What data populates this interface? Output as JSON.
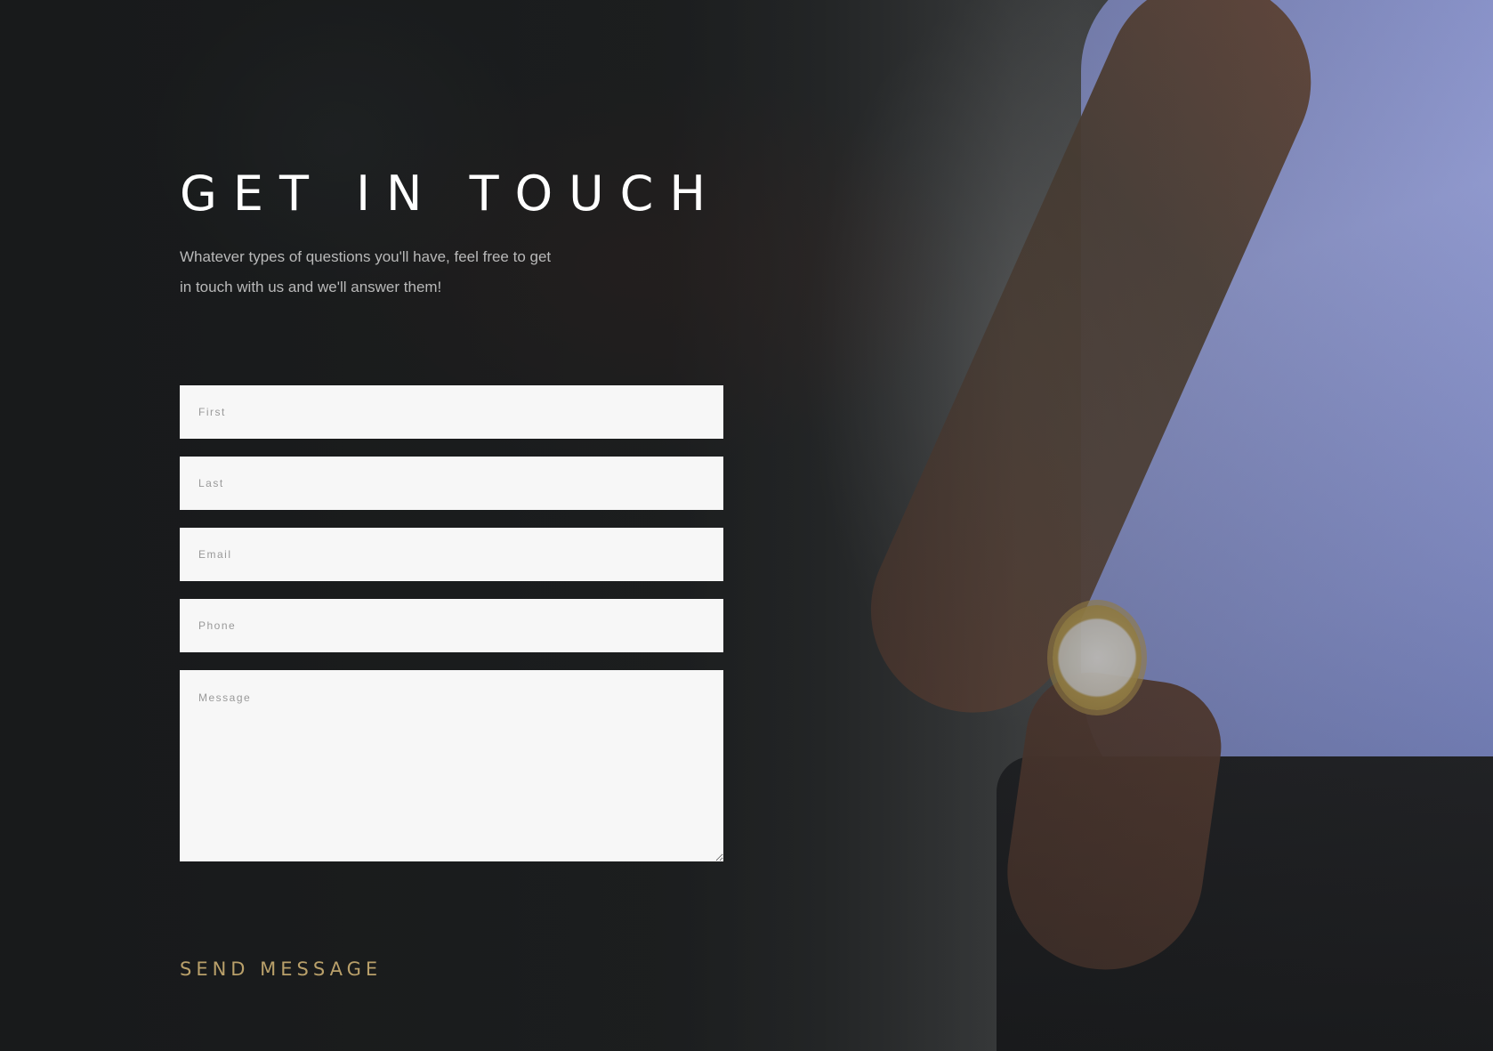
{
  "contact": {
    "title": "GET IN TOUCH",
    "subtitle": "Whatever types of questions you'll have, feel free to get in touch with us and we'll answer them!",
    "fields": {
      "first": {
        "placeholder": "First",
        "value": ""
      },
      "last": {
        "placeholder": "Last",
        "value": ""
      },
      "email": {
        "placeholder": "Email",
        "value": ""
      },
      "phone": {
        "placeholder": "Phone",
        "value": ""
      },
      "message": {
        "placeholder": "Message",
        "value": ""
      }
    },
    "send_label": "SEND MESSAGE"
  },
  "colors": {
    "accent": "#b9a06a",
    "field_background": "#f7f7f7",
    "title": "#ffffff",
    "subtitle": "#b9b9b9"
  }
}
